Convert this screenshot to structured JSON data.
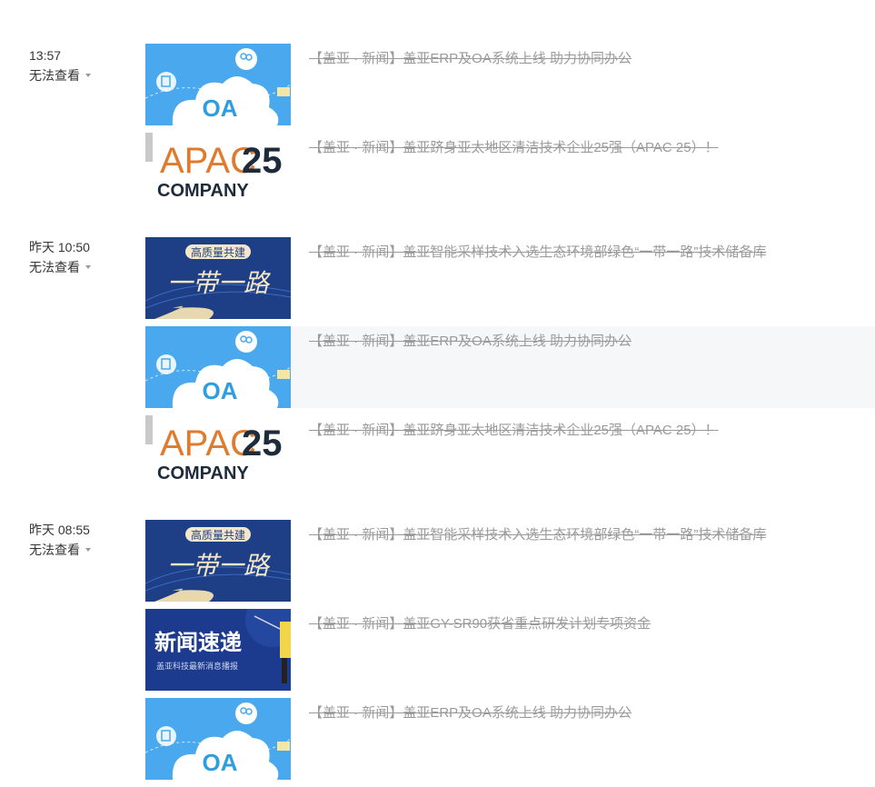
{
  "groups": [
    {
      "time": "13:57",
      "status": "无法查看",
      "items": [
        {
          "thumb": "oa",
          "title": "【盖亚 · 新闻】盖亚ERP及OA系统上线 助力协同办公"
        },
        {
          "thumb": "apac",
          "title": "【盖亚 · 新闻】盖亚跻身亚太地区清洁技术企业25强（APAC 25）！"
        }
      ]
    },
    {
      "time": "昨天 10:50",
      "status": "无法查看",
      "items": [
        {
          "thumb": "belt",
          "title": "【盖亚 · 新闻】盖亚智能采样技术入选生态环境部绿色“一带一路”技术储备库"
        },
        {
          "thumb": "oa",
          "title": "【盖亚 · 新闻】盖亚ERP及OA系统上线 助力协同办公"
        },
        {
          "thumb": "apac",
          "title": "【盖亚 · 新闻】盖亚跻身亚太地区清洁技术企业25强（APAC 25）！"
        }
      ]
    },
    {
      "time": "昨天 08:55",
      "status": "无法查看",
      "items": [
        {
          "thumb": "belt",
          "title": "【盖亚 · 新闻】盖亚智能采样技术入选生态环境部绿色“一带一路”技术储备库"
        },
        {
          "thumb": "news",
          "title": "【盖亚 · 新闻】盖亚GY-SR90获省重点研发计划专项资金"
        },
        {
          "thumb": "oa",
          "title": "【盖亚 · 新闻】盖亚ERP及OA系统上线 助力协同办公"
        }
      ]
    }
  ],
  "thumbs": {
    "oa": {
      "text": "OA",
      "icon": "cloud-icon"
    },
    "apac": {
      "line1": "APAC",
      "num": "25",
      "line2": "COMPANY"
    },
    "belt": {
      "banner": "高质量共建",
      "big": "一带一路"
    },
    "news": {
      "big": "新闻速递",
      "sub": "盖亚科技最新消息播报"
    }
  },
  "colors": {
    "oa_bg": "#4aa8ee",
    "apac_orange": "#e07a2c",
    "apac_navy": "#1d2b3a",
    "belt_bg": "#1e3f86",
    "news_bg": "#1c3a8e",
    "title": "#9a9a9a"
  }
}
